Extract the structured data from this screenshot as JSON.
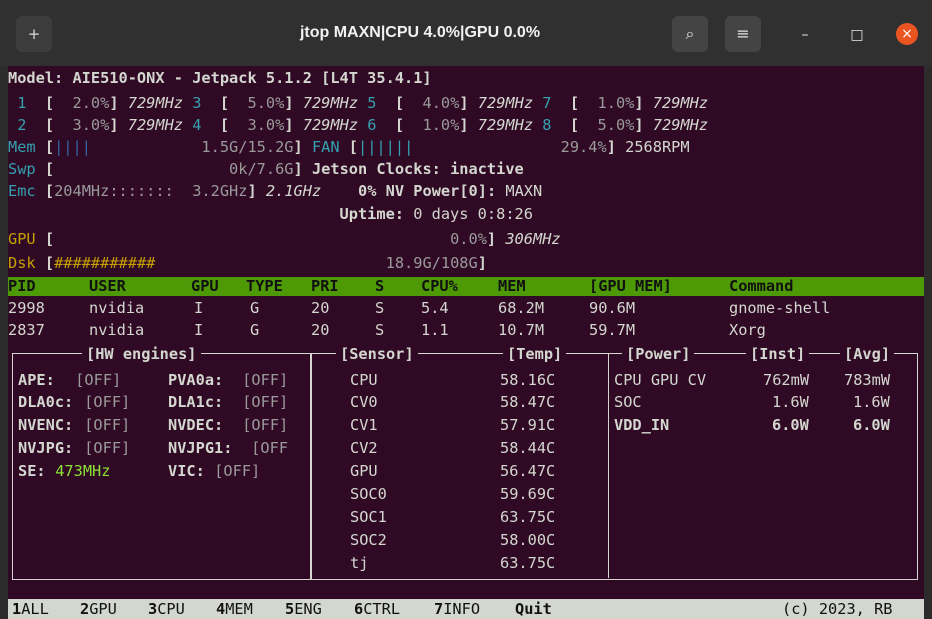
{
  "window": {
    "title": "jtop MAXN|CPU 4.0%|GPU 0.0%",
    "newtab_icon": "+",
    "search_icon": "⌕",
    "menu_icon": "≡",
    "minimize_icon": "–",
    "maximize_icon": "□",
    "close_icon": "×",
    "accent": "#e95420"
  },
  "l0": {
    "a": "Model: AIE510-ONX - Jetpack 5.1.2 [L4T 35.4.1]"
  },
  "l1": {
    "a": " 1 ",
    "b": " [  ",
    "c": "2.0%",
    "d": "] ",
    "e": "729MHz",
    "f": " 3 ",
    "g": " [  ",
    "h": "5.0%",
    "i": "] ",
    "j": "729MHz",
    "k": " 5 ",
    "l": " [  ",
    "m": "4.0%",
    "n": "] ",
    "o": "729MHz",
    "p": " 7 ",
    "q": " [  ",
    "r": "1.0%",
    "s": "] ",
    "t": "729MHz"
  },
  "l2": {
    "a": " 2 ",
    "b": " [  ",
    "c": "3.0%",
    "d": "] ",
    "e": "729MHz",
    "f": " 4 ",
    "g": " [  ",
    "h": "3.0%",
    "i": "] ",
    "j": "729MHz",
    "k": " 6 ",
    "l": " [  ",
    "m": "1.0%",
    "n": "] ",
    "o": "729MHz",
    "p": " 8 ",
    "q": " [  ",
    "r": "5.0%",
    "s": "] ",
    "t": "729MHz"
  },
  "l3": {
    "a": "Mem ",
    "b": "[",
    "c": "||||",
    "d": "            1.5G/15.2G",
    "e": "]",
    "f": " FAN ",
    "g": "[",
    "h": "||||||",
    "i": "                ",
    "j": "29.4%",
    "k": "]",
    "l": " 2568RPM"
  },
  "l4": {
    "a": "Swp ",
    "b": "[",
    "c": "                   0k/7.6G",
    "d": "]",
    "e": " Jetson Clocks: inactive"
  },
  "l5": {
    "a": "Emc ",
    "b": "[",
    "c": "204MHz",
    "d": ":::::::",
    "e": "  3.2GHz",
    "f": "]",
    "g": " 2.1GHz",
    "h": "    0%",
    "i": " NV Power[0]: ",
    "j": "MAXN"
  },
  "l6": {
    "a": "                                    Uptime: ",
    "b": "0 days 0:8:26"
  },
  "l7": {
    "a": "GPU ",
    "b": "[",
    "c": "                                           0.0%",
    "d": "]",
    "e": " 306MHz"
  },
  "l8": {
    "a": "Dsk ",
    "b": "[",
    "c": "###########",
    "d": "                         18.9G/108G",
    "e": "]"
  },
  "procs": {
    "headers": [
      "PID",
      "USER",
      "GPU",
      "TYPE",
      "PRI",
      "S",
      "CPU%",
      "MEM",
      "[GPU MEM]",
      "Command"
    ],
    "rows": [
      [
        "2998",
        "nvidia",
        "I",
        "G",
        "20",
        "S",
        "5.4",
        "68.2M",
        "90.6M",
        "gnome-shell"
      ],
      [
        "2837",
        "nvidia",
        "I",
        "G",
        "20",
        "S",
        "1.1",
        "10.7M",
        "59.7M",
        "Xorg"
      ]
    ]
  },
  "hw": {
    "title": "[HW engines]",
    "rows": [
      {
        "k1": "APE:",
        "v1": " [OFF]",
        "k2": "PVA0a:",
        "v2": " [OFF]"
      },
      {
        "k1": "DLA0c:",
        "v1": " [OFF]",
        "k2": "DLA1c:",
        "v2": " [OFF]"
      },
      {
        "k1": "NVENC:",
        "v1": " [OFF]",
        "k2": "NVDEC:",
        "v2": " [OFF]"
      },
      {
        "k1": "NVJPG:",
        "v1": " [OFF]",
        "k2": "NVJPG1:",
        "v2": " [OFF"
      },
      {
        "k1": "SE:",
        "v1": " 473MHz",
        "k2": "VIC:",
        "v2": " [OFF]"
      }
    ]
  },
  "sensor": {
    "title": "[Sensor]",
    "temp_title": "[Temp]",
    "rows": [
      {
        "name": "CPU",
        "temp": "58.16C"
      },
      {
        "name": "CV0",
        "temp": "58.47C"
      },
      {
        "name": "CV1",
        "temp": "57.91C"
      },
      {
        "name": "CV2",
        "temp": "58.44C"
      },
      {
        "name": "GPU",
        "temp": "56.47C"
      },
      {
        "name": "SOC0",
        "temp": "59.69C"
      },
      {
        "name": "SOC1",
        "temp": "63.75C"
      },
      {
        "name": "SOC2",
        "temp": "58.00C"
      },
      {
        "name": "tj",
        "temp": "63.75C"
      }
    ]
  },
  "power": {
    "title": "[Power]",
    "inst_title": "[Inst]",
    "avg_title": "[Avg]",
    "rows": [
      {
        "name": "CPU GPU CV",
        "inst": "762mW",
        "avg": "783mW"
      },
      {
        "name": "SOC",
        "inst": "1.6W",
        "avg": "1.6W"
      },
      {
        "name": "VDD_IN",
        "inst": "6.0W",
        "avg": "6.0W"
      }
    ]
  },
  "footer": {
    "tabs": [
      {
        "num": "1",
        "label": "ALL"
      },
      {
        "num": "2",
        "label": "GPU"
      },
      {
        "num": "3",
        "label": "CPU"
      },
      {
        "num": "4",
        "label": "MEM"
      },
      {
        "num": "5",
        "label": "ENG"
      },
      {
        "num": "6",
        "label": "CTRL"
      },
      {
        "num": "7",
        "label": "INFO"
      },
      {
        "num": "",
        "label": "Quit"
      }
    ],
    "copyright": "(c) 2023, RB"
  }
}
